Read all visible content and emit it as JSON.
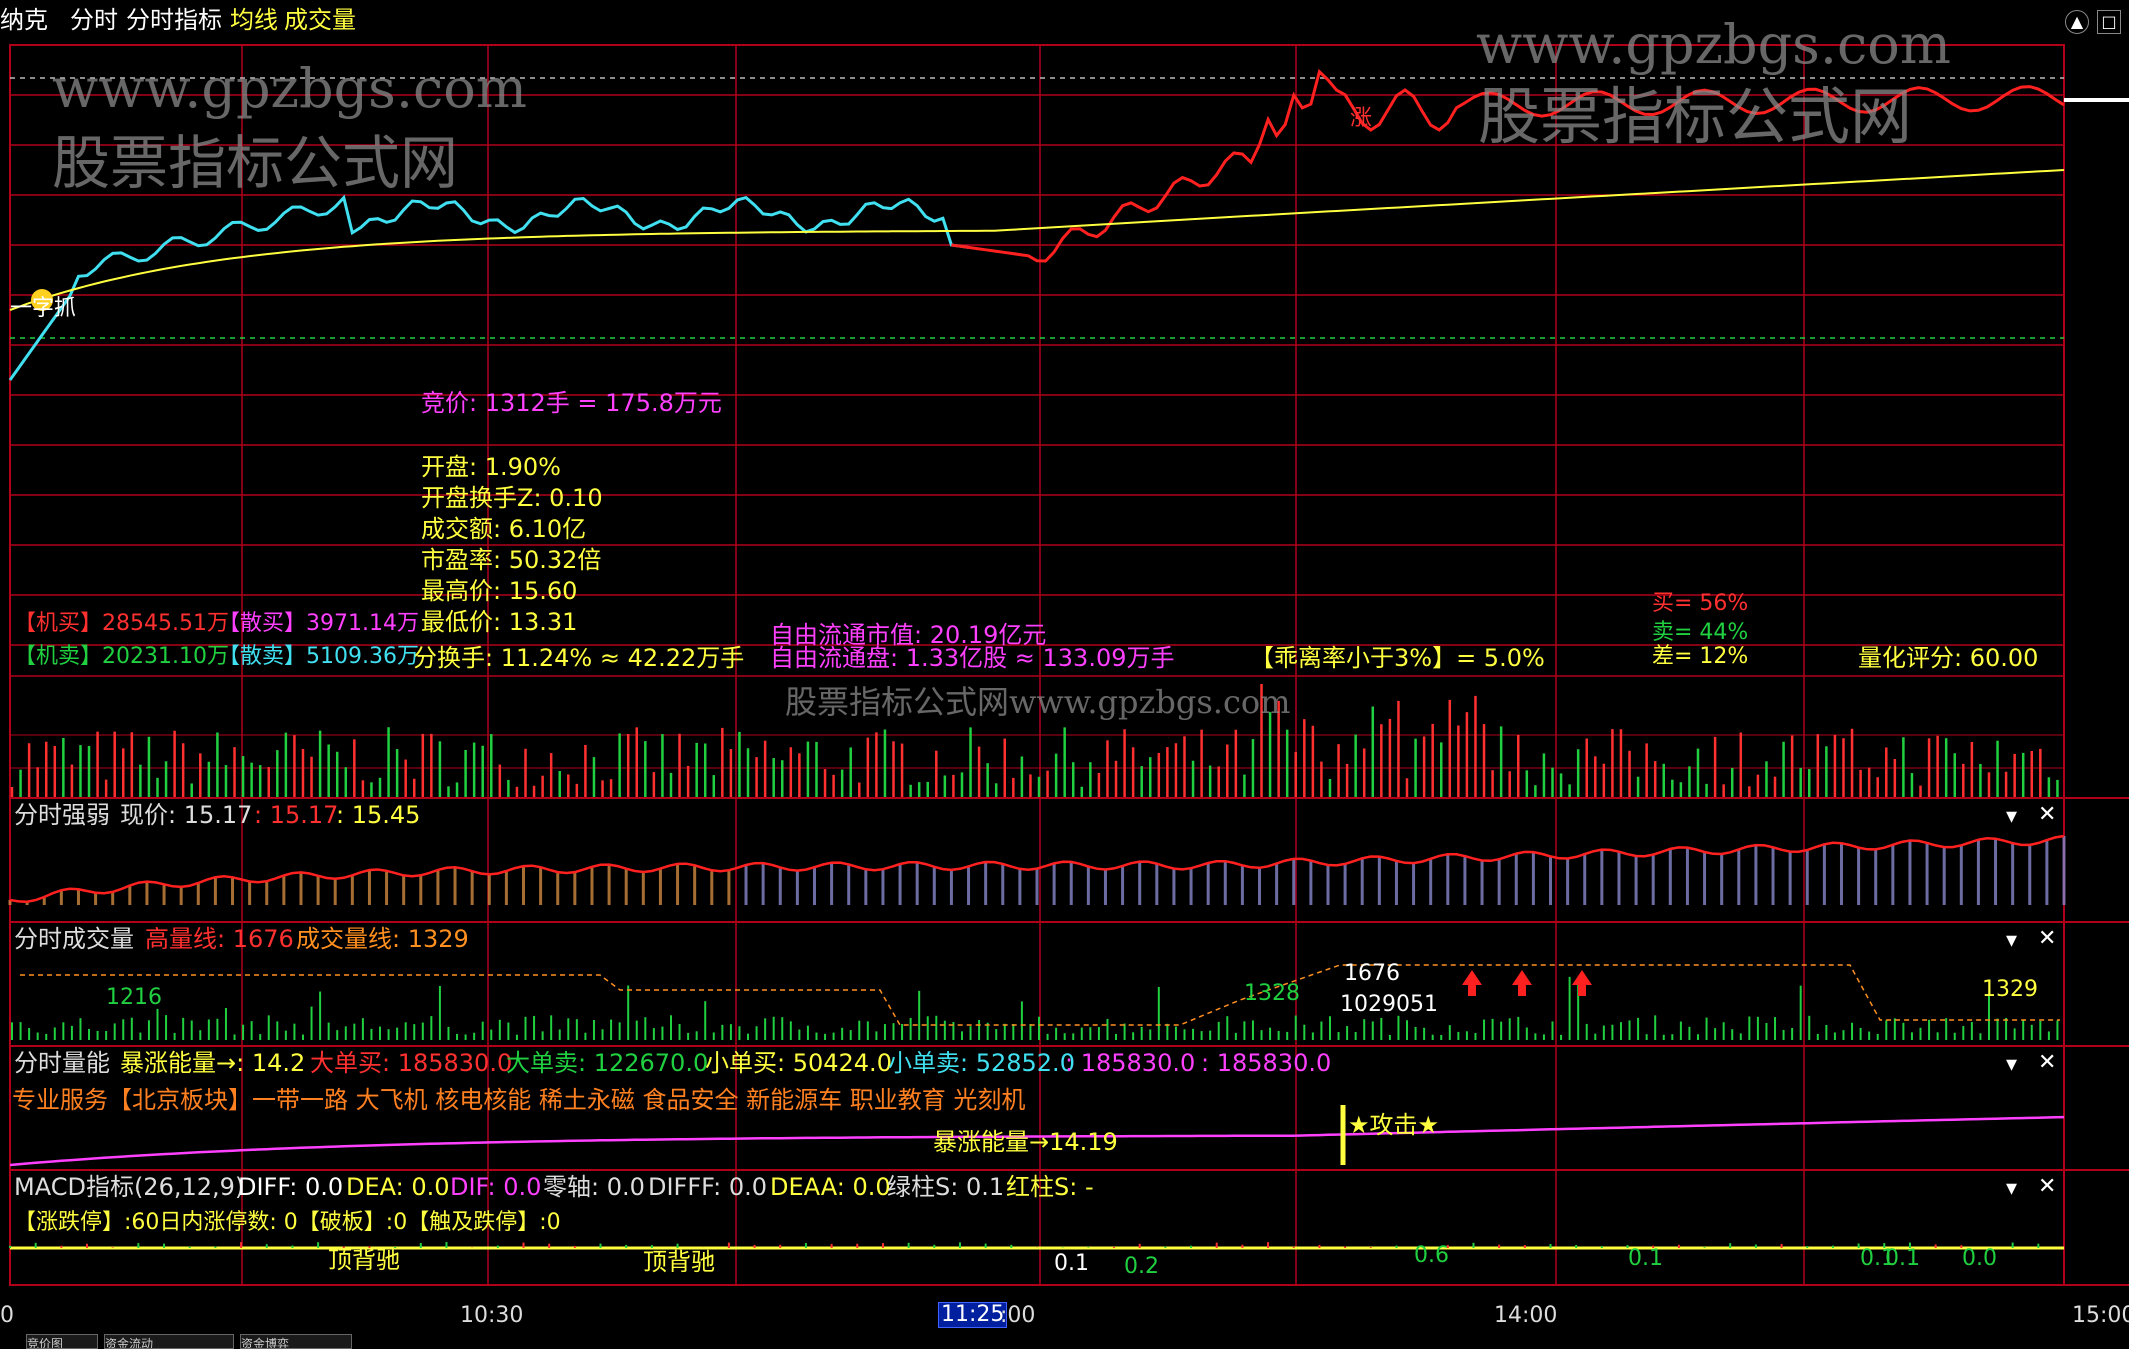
{
  "header": {
    "stock_name": "纳克",
    "tabs": [
      "分时",
      "分时指标",
      "均线",
      "成交量"
    ],
    "top_right_icons": [
      "up-arrow-icon",
      "maximize-icon"
    ]
  },
  "watermarks": {
    "url": "www.gpzbgs.com",
    "site_cn": "股票指标公式网",
    "mid": "股票指标公式网www.gpzbgs.com"
  },
  "main_panel": {
    "price_labels": {
      "marker_text": "涨",
      "start_marker": "一字抓"
    },
    "auction": "竞价: 1312手 = 175.8万元",
    "stats": [
      "开盘: 1.90%",
      "开盘换手Z: 0.10",
      "成交额: 6.10亿",
      "市盈率: 50.32倍",
      "最高价: 15.60",
      "最低价: 13.31"
    ],
    "turnover": "分换手: 11.24% ≈ 42.22万手",
    "inst_buy": "【机买】28545.51万",
    "retail_buy": "【散买】3971.14万",
    "inst_sell": "【机卖】20231.10万",
    "retail_sell": "【散卖】5109.36万",
    "float_mkt_cap": "自由流通市值: 20.19亿元",
    "float_shares": "自由流通盘: 1.33亿股 ≈ 133.09万手",
    "deviation": "【乖离率小于3%】= 5.0%",
    "buy_pct": "买= 56%",
    "sell_pct": "卖= 44%",
    "diff_pct": "差= 12%",
    "score": "量化评分: 60.00"
  },
  "panels": {
    "strength": {
      "title": "分时强弱",
      "price_label": "现价: 15.17",
      "v1": ": 15.17",
      "v2": ": 15.45"
    },
    "volume": {
      "title": "分时成交量",
      "high_label": "高量线: 1676",
      "vol_label": "成交量线: 1329",
      "marks": [
        "1216",
        "1328",
        "1676",
        "1029051",
        "1329"
      ]
    },
    "energy": {
      "title": "分时量能",
      "surge": "暴涨能量→: 14.2",
      "big_buy": "大单买: 185830.0",
      "big_sell": "大单卖: 122670.0",
      "small_buy": "小单买: 50424.0",
      "small_sell": "小单卖: 52852.0",
      "v1": ": 185830.0",
      "v2": ": 185830.0",
      "sectors": "专业服务【北京板块】一带一路 大飞机 核电核能 稀土永磁 食品安全 新能源车 职业教育 光刻机",
      "surge_mark": "暴涨能量→14.19",
      "attack": "★攻击★"
    },
    "macd": {
      "title": "MACD指标(26,12,9)",
      "diff": "DIFF: 0.0",
      "dea": "DEA: 0.0",
      "dif": "DIF: 0.0",
      "zero": "零轴: 0.0",
      "difff": "DIFFF: 0.0",
      "deaa": "DEAA: 0.0",
      "green": "绿柱S: 0.1",
      "red": "红柱S: -",
      "limit_line": "【涨跌停】:60日内涨停数: 0【破板】:0【触及跌停】:0",
      "div1": "顶背驰",
      "div2": "顶背驰",
      "small": [
        "0.1",
        "0.2",
        "0.6",
        "0.1",
        "0.1",
        "0.1",
        "0.0"
      ]
    }
  },
  "time_axis": {
    "labels": [
      "0",
      "10:30",
      "11:25",
      ":00",
      "14:00",
      "15:00"
    ]
  },
  "bottom_tabs": [
    "竞价图",
    "资金流动",
    "资金博弈"
  ],
  "colors": {
    "grid": "#b0001a",
    "avg": "#ffff40",
    "price_up": "#ff2020",
    "price_down": "#40e0f0",
    "vol_up": "#ff3030",
    "vol_down": "#20d040"
  }
}
